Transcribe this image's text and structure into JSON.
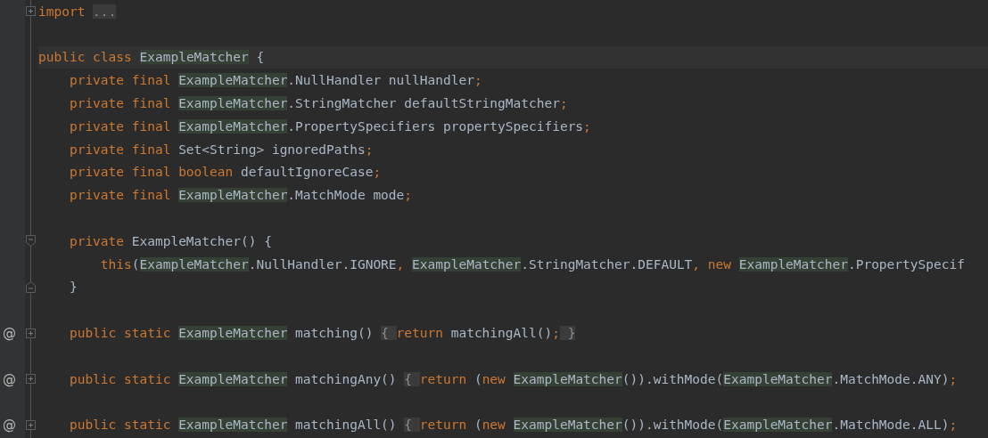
{
  "editor": {
    "lines": [
      {
        "kind": "code",
        "fold": {
          "kind": "collapsed"
        },
        "tokens": [
          {
            "kind": "kw",
            "t": "import "
          },
          {
            "kind": "folded",
            "t": "..."
          }
        ]
      },
      {
        "kind": "blank"
      },
      {
        "kind": "code",
        "current": true,
        "tokens": [
          {
            "kind": "kw",
            "t": "public class "
          },
          {
            "kind": "type",
            "t": "ExampleMatcher"
          },
          {
            "kind": "plain",
            "t": " {"
          }
        ]
      },
      {
        "kind": "code",
        "tokens": [
          {
            "kind": "kw",
            "t": "    private final "
          },
          {
            "kind": "type",
            "t": "ExampleMatcher"
          },
          {
            "kind": "plain",
            "t": ".NullHandler nullHandler"
          },
          {
            "kind": "punct",
            "t": ";"
          }
        ]
      },
      {
        "kind": "code",
        "tokens": [
          {
            "kind": "kw",
            "t": "    private final "
          },
          {
            "kind": "type",
            "t": "ExampleMatcher"
          },
          {
            "kind": "plain",
            "t": ".StringMatcher defaultStringMatcher"
          },
          {
            "kind": "punct",
            "t": ";"
          }
        ]
      },
      {
        "kind": "code",
        "tokens": [
          {
            "kind": "kw",
            "t": "    private final "
          },
          {
            "kind": "type",
            "t": "ExampleMatcher"
          },
          {
            "kind": "plain",
            "t": ".PropertySpecifiers propertySpecifiers"
          },
          {
            "kind": "punct",
            "t": ";"
          }
        ]
      },
      {
        "kind": "code",
        "tokens": [
          {
            "kind": "kw",
            "t": "    private final "
          },
          {
            "kind": "plain",
            "t": "Set<String> ignoredPaths"
          },
          {
            "kind": "punct",
            "t": ";"
          }
        ]
      },
      {
        "kind": "code",
        "tokens": [
          {
            "kind": "kw",
            "t": "    private final boolean "
          },
          {
            "kind": "plain",
            "t": "defaultIgnoreCase"
          },
          {
            "kind": "punct",
            "t": ";"
          }
        ]
      },
      {
        "kind": "code",
        "tokens": [
          {
            "kind": "kw",
            "t": "    private final "
          },
          {
            "kind": "type",
            "t": "ExampleMatcher"
          },
          {
            "kind": "plain",
            "t": ".MatchMode mode"
          },
          {
            "kind": "punct",
            "t": ";"
          }
        ]
      },
      {
        "kind": "blank"
      },
      {
        "kind": "code",
        "fold": {
          "kind": "start"
        },
        "tokens": [
          {
            "kind": "kw",
            "t": "    private "
          },
          {
            "kind": "plain",
            "t": "ExampleMatcher() {"
          }
        ]
      },
      {
        "kind": "code",
        "tokens": [
          {
            "kind": "kw",
            "t": "        this"
          },
          {
            "kind": "plain",
            "t": "("
          },
          {
            "kind": "type",
            "t": "ExampleMatcher"
          },
          {
            "kind": "plain",
            "t": ".NullHandler.IGNORE"
          },
          {
            "kind": "punct",
            "t": ", "
          },
          {
            "kind": "type",
            "t": "ExampleMatcher"
          },
          {
            "kind": "plain",
            "t": ".StringMatcher.DEFAULT"
          },
          {
            "kind": "punct",
            "t": ", "
          },
          {
            "kind": "kw",
            "t": "new "
          },
          {
            "kind": "type",
            "t": "ExampleMatcher"
          },
          {
            "kind": "plain",
            "t": ".PropertySpecif"
          }
        ]
      },
      {
        "kind": "code",
        "fold": {
          "kind": "end"
        },
        "tokens": [
          {
            "kind": "plain",
            "t": "    }"
          }
        ]
      },
      {
        "kind": "blank"
      },
      {
        "kind": "code",
        "gutter_mark": "@",
        "fold": {
          "kind": "collapsed"
        },
        "tokens": [
          {
            "kind": "kw",
            "t": "    public static "
          },
          {
            "kind": "type",
            "t": "ExampleMatcher"
          },
          {
            "kind": "plain",
            "t": " matching() "
          },
          {
            "kind": "folded",
            "t": "{ "
          },
          {
            "kind": "kw",
            "t": "return "
          },
          {
            "kind": "plain",
            "t": "matchingAll()"
          },
          {
            "kind": "punct",
            "t": ";"
          },
          {
            "kind": "folded",
            "t": " }"
          }
        ]
      },
      {
        "kind": "blank"
      },
      {
        "kind": "code",
        "gutter_mark": "@",
        "fold": {
          "kind": "collapsed"
        },
        "tokens": [
          {
            "kind": "kw",
            "t": "    public static "
          },
          {
            "kind": "type",
            "t": "ExampleMatcher"
          },
          {
            "kind": "plain",
            "t": " matchingAny() "
          },
          {
            "kind": "folded",
            "t": "{ "
          },
          {
            "kind": "kw",
            "t": "return "
          },
          {
            "kind": "plain",
            "t": "("
          },
          {
            "kind": "kw",
            "t": "new "
          },
          {
            "kind": "type",
            "t": "ExampleMatcher"
          },
          {
            "kind": "plain",
            "t": "()).withMode("
          },
          {
            "kind": "type",
            "t": "ExampleMatcher"
          },
          {
            "kind": "plain",
            "t": ".MatchMode.ANY)"
          },
          {
            "kind": "punct",
            "t": ";"
          }
        ]
      },
      {
        "kind": "blank"
      },
      {
        "kind": "code",
        "gutter_mark": "@",
        "fold": {
          "kind": "collapsed"
        },
        "tokens": [
          {
            "kind": "kw",
            "t": "    public static "
          },
          {
            "kind": "type",
            "t": "ExampleMatcher"
          },
          {
            "kind": "plain",
            "t": " matchingAll() "
          },
          {
            "kind": "folded",
            "t": "{ "
          },
          {
            "kind": "kw",
            "t": "return "
          },
          {
            "kind": "plain",
            "t": "("
          },
          {
            "kind": "kw",
            "t": "new "
          },
          {
            "kind": "type",
            "t": "ExampleMatcher"
          },
          {
            "kind": "plain",
            "t": "()).withMode("
          },
          {
            "kind": "type",
            "t": "ExampleMatcher"
          },
          {
            "kind": "plain",
            "t": ".MatchMode.ALL)"
          },
          {
            "kind": "punct",
            "t": ";"
          }
        ]
      }
    ]
  }
}
